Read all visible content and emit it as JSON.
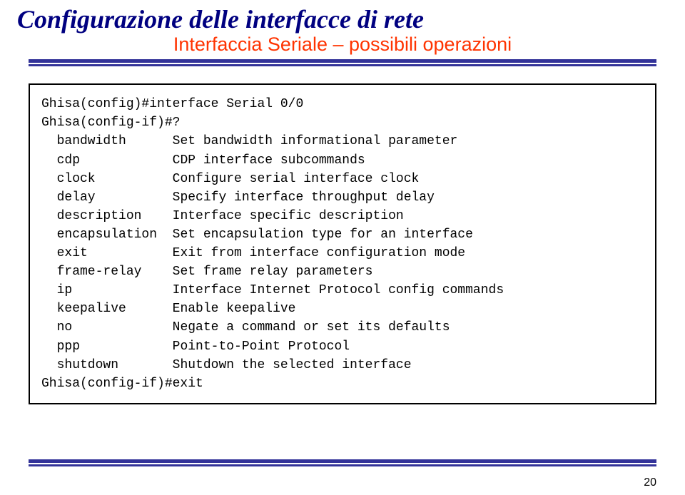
{
  "title": "Configurazione delle interfacce di rete",
  "subtitle": "Interfaccia Seriale – possibili operazioni",
  "terminal": {
    "line1": "Ghisa(config)#interface Serial 0/0",
    "line2": "Ghisa(config-if)#?",
    "rows": [
      {
        "cmd": "  bandwidth",
        "desc": "Set bandwidth informational parameter"
      },
      {
        "cmd": "  cdp",
        "desc": "CDP interface subcommands"
      },
      {
        "cmd": "  clock",
        "desc": "Configure serial interface clock"
      },
      {
        "cmd": "  delay",
        "desc": "Specify interface throughput delay"
      },
      {
        "cmd": "  description",
        "desc": "Interface specific description"
      },
      {
        "cmd": "  encapsulation",
        "desc": "Set encapsulation type for an interface"
      },
      {
        "cmd": "  exit",
        "desc": "Exit from interface configuration mode"
      },
      {
        "cmd": "  frame-relay",
        "desc": "Set frame relay parameters"
      },
      {
        "cmd": "  ip",
        "desc": "Interface Internet Protocol config commands"
      },
      {
        "cmd": "  keepalive",
        "desc": "Enable keepalive"
      },
      {
        "cmd": "  no",
        "desc": "Negate a command or set its defaults"
      },
      {
        "cmd": "  ppp",
        "desc": "Point-to-Point Protocol"
      },
      {
        "cmd": "  shutdown",
        "desc": "Shutdown the selected interface"
      }
    ],
    "blank": "",
    "line_last": "Ghisa(config-if)#exit"
  },
  "page_number": "20"
}
